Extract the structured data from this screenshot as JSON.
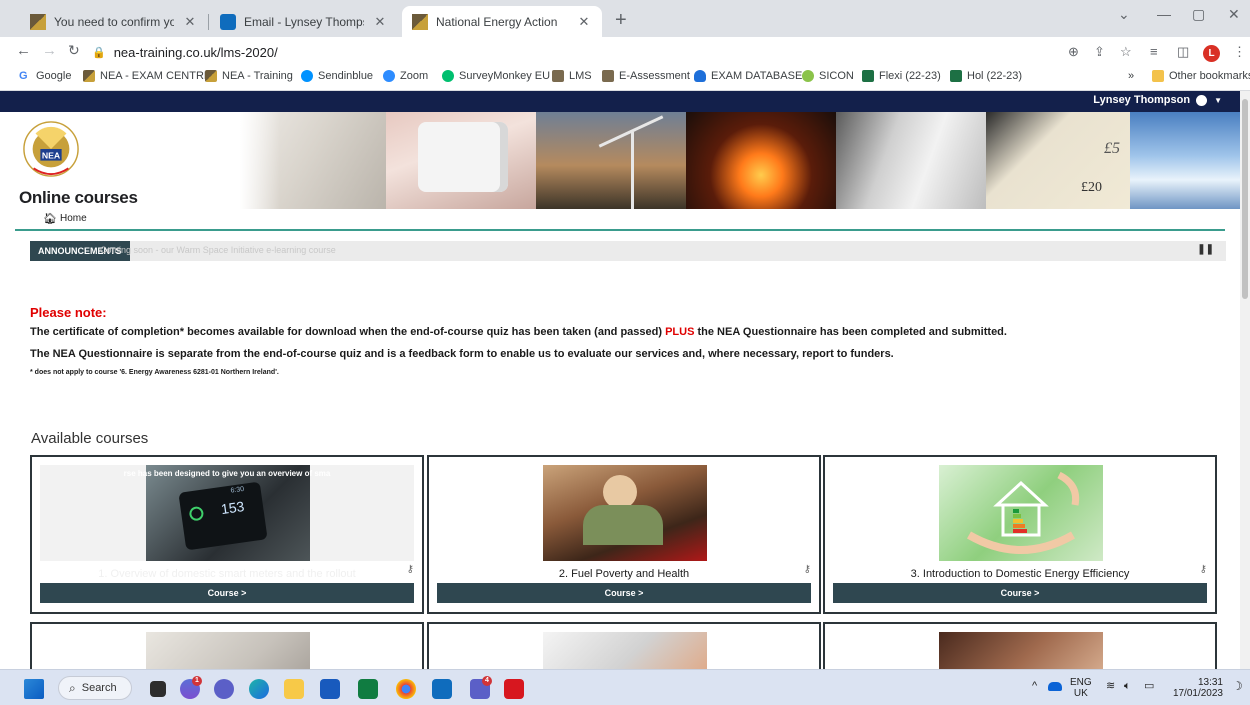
{
  "browser": {
    "tabs": [
      {
        "title": "You need to confirm your accoun",
        "active": false
      },
      {
        "title": "Email - Lynsey Thompson - Outlo",
        "active": false
      },
      {
        "title": "National Energy Action",
        "active": true
      }
    ],
    "url": "nea-training.co.uk/lms-2020/",
    "profile_initial": "L",
    "bookmarks": [
      {
        "label": "Google",
        "color": "#4285f4"
      },
      {
        "label": "NEA - EXAM CENTRE",
        "color": "#c7a03a"
      },
      {
        "label": "NEA - Training",
        "color": "#c7a03a"
      },
      {
        "label": "Sendinblue",
        "color": "#0092ff"
      },
      {
        "label": "Zoom",
        "color": "#2d8cff"
      },
      {
        "label": "SurveyMonkey EU",
        "color": "#00bf6f"
      },
      {
        "label": "LMS",
        "color": "#7a6a4f"
      },
      {
        "label": "E-Assessment",
        "color": "#7a6a4f"
      },
      {
        "label": "EXAM DATABASE",
        "color": "#1e6fd9"
      },
      {
        "label": "SICON",
        "color": "#8bc34a"
      },
      {
        "label": "Flexi (22-23)",
        "color": "#1d7044"
      },
      {
        "label": "Hol (22-23)",
        "color": "#1d7044"
      }
    ],
    "more_bookmarks": "»",
    "other_bookmarks": "Other bookmarks"
  },
  "site": {
    "user_name": "Lynsey Thompson",
    "title": "Online courses",
    "logo_text": "NEA",
    "logo_ring_top": "NATIONAL ENERGY ACTION",
    "logo_ring_bottom": "ACTION FOR WARM HOMES",
    "breadcrumb_home": "Home",
    "announcement_label": "ANNOUNCEMENTS",
    "announcement_text": "Coming soon - our Warm Space Initiative e-learning course",
    "pause_symbol": "❚❚"
  },
  "notice": {
    "title": "Please note:",
    "line1_a": "The certificate of completion* becomes available for download when the end-of-course quiz has been taken (and passed)",
    "line1_plus": "PLUS",
    "line1_b": "the NEA Questionnaire has been completed and submitted.",
    "line2": "The NEA Questionnaire is separate from the end-of-course quiz and is a feedback form to enable us to evaluate our services and, where necessary, report to funders.",
    "footnote": "* does not apply to course '6. Energy Awareness 6281-01 Northern Ireland'."
  },
  "courses": {
    "heading": "Available courses",
    "items": [
      {
        "title": "1. Overview of domestic smart meters and the rollout",
        "button": "Course >",
        "overlay_text": "rse has been designed to give you an overview of sma",
        "meter_value": "153",
        "meter_time": "6:30"
      },
      {
        "title": "2. Fuel Poverty and Health",
        "button": "Course >"
      },
      {
        "title": "3. Introduction to Domestic Energy Efficiency",
        "button": "Course >"
      }
    ]
  },
  "taskbar": {
    "search_label": "Search",
    "people_badge": "1",
    "teams_badge": "4",
    "lang_top": "ENG",
    "lang_bottom": "UK",
    "time": "13:31",
    "date": "17/01/2023"
  }
}
